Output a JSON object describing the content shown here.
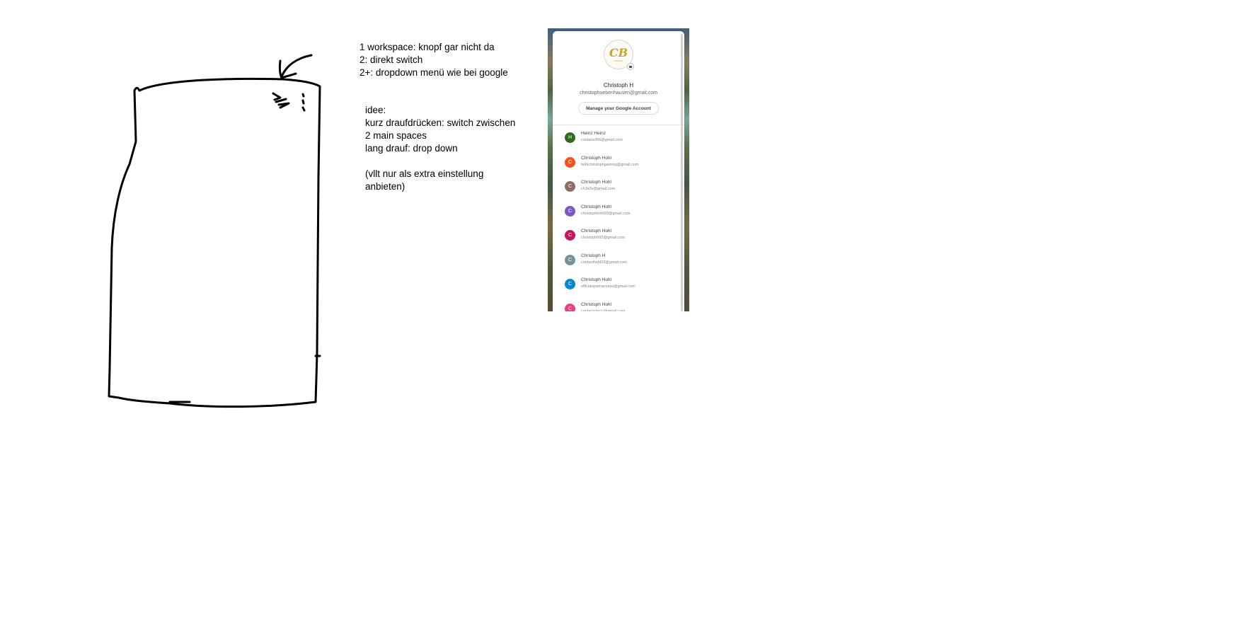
{
  "notes": {
    "block1": "1 workspace: knopf gar nicht da\n2: direkt switch\n2+: dropdown menü wie bei google",
    "block2": "idee:\nkurz draufdrücken: switch zwischen\n2 main spaces\nlang drauf: drop down\n\n(vllt nur als extra einstellung\nanbieten)"
  },
  "account_panel": {
    "logo_letters": "CB",
    "logo_sub": "Christoph",
    "user_name": "Christoph H",
    "user_email": "christophoebenhausen@gmail.com",
    "manage_label": "Manage your Google Account",
    "accounts": [
      {
        "initial": "H",
        "name": "Heinz Heinz",
        "email": "contactcf96@gmail.com",
        "color": "#33691e"
      },
      {
        "initial": "C",
        "name": "Christoph Hohl",
        "email": "hohlchristophgaming@gmail.com",
        "color": "#f4511e"
      },
      {
        "initial": "C",
        "name": "Christoph Hohl",
        "email": "ch1k3v@gmail.com",
        "color": "#8d6e63"
      },
      {
        "initial": "C",
        "name": "Christoph Hohl",
        "email": "christophhohl93@gmail.com",
        "color": "#7e57c2"
      },
      {
        "initial": "C",
        "name": "Christoph Hohl",
        "email": "christophh93@gmail.com",
        "color": "#c2185b"
      },
      {
        "initial": "C",
        "name": "Christoph H",
        "email": "contacthohl93@gmail.com",
        "color": "#78909c"
      },
      {
        "initial": "C",
        "name": "Christoph Hohl",
        "email": "officialspamaccess@gmail.com",
        "color": "#0288d1"
      },
      {
        "initial": "C",
        "name": "Christoph Hohl",
        "email": "contactcbccc@gmail.com",
        "color": "#ec407a"
      }
    ]
  }
}
